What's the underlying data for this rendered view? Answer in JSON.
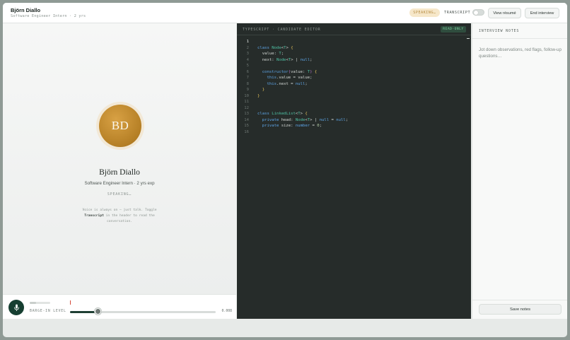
{
  "header": {
    "candidate_name": "Björn Diallo",
    "candidate_meta": "Software Engineer Intern · 2 yrs",
    "status_pill": "SPEAKING…",
    "transcript_label": "TRANSCRIPT",
    "transcript_on": false,
    "view_resume_label": "View résumé",
    "end_interview_label": "End interview"
  },
  "candidate_panel": {
    "initials": "BD",
    "name": "Björn Diallo",
    "role": "Software Engineer Intern · 2 yrs exp",
    "status": "SPEAKING…",
    "hint_prefix": "Voice is always on — just talk. Toggle",
    "hint_link": "Transcript",
    "hint_suffix": "in the header to read the conversation."
  },
  "audio_controls": {
    "mic_icon": "microphone-icon",
    "level_fraction": 0.08,
    "barge_in_label": "BARGE-IN LEVEL",
    "barge_in_fraction": 0.19,
    "barge_in_value": "0.008"
  },
  "editor": {
    "title": "TYPESCRIPT · CANDIDATE EDITOR",
    "badge": "READ-ONLY",
    "active_line": 1,
    "lines": [
      "",
      "class Node<T> {",
      "  value: T;",
      "  next: Node<T> | null;",
      "",
      "  constructor(value: T) {",
      "    this.value = value;",
      "    this.next = null;",
      "  }",
      "}",
      "",
      "",
      "class LinkedList<T> {",
      "  private head: Node<T> | null = null;",
      "  private size: number = 0;",
      ""
    ]
  },
  "notes": {
    "title": "INTERVIEW NOTES",
    "placeholder": "Jot down observations, red flags, follow-up questions…",
    "save_label": "Save notes"
  },
  "colors": {
    "mic_button": "#163f31",
    "avatar": "#b57f25",
    "speaking_pill_bg": "#f6e7c9",
    "editor_bg": "#262c2a",
    "readonly_badge": "#7ed6a2"
  }
}
